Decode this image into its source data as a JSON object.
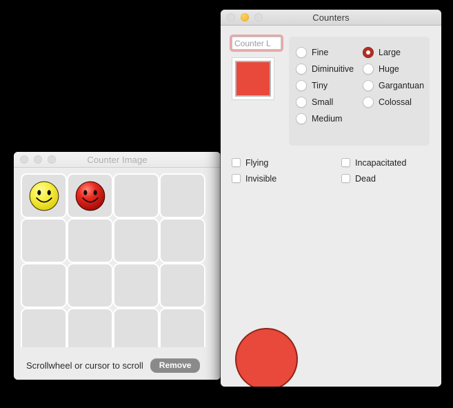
{
  "desktop": {
    "background_color": "#000000"
  },
  "counter_image_window": {
    "title": "Counter Image",
    "active": false,
    "traffic_lights": [
      {
        "name": "close-button",
        "color": "#dcdcdc"
      },
      {
        "name": "minimize-button",
        "color": "#dcdcdc"
      },
      {
        "name": "zoom-button",
        "color": "#dcdcdc"
      }
    ],
    "grid": {
      "columns": 4,
      "rows": 4,
      "cells": [
        {
          "icon": "smiley-face-icon",
          "color": "#f2e838",
          "filled": true
        },
        {
          "icon": "smiley-face-icon",
          "color": "#e02020",
          "filled": true
        },
        {
          "icon": "",
          "color": "",
          "filled": false
        },
        {
          "icon": "",
          "color": "",
          "filled": false
        },
        {
          "icon": "",
          "color": "",
          "filled": false
        },
        {
          "icon": "",
          "color": "",
          "filled": false
        },
        {
          "icon": "",
          "color": "",
          "filled": false
        },
        {
          "icon": "",
          "color": "",
          "filled": false
        },
        {
          "icon": "",
          "color": "",
          "filled": false
        },
        {
          "icon": "",
          "color": "",
          "filled": false
        },
        {
          "icon": "",
          "color": "",
          "filled": false
        },
        {
          "icon": "",
          "color": "",
          "filled": false
        },
        {
          "icon": "",
          "color": "",
          "filled": false
        },
        {
          "icon": "",
          "color": "",
          "filled": false
        },
        {
          "icon": "",
          "color": "",
          "filled": false
        },
        {
          "icon": "",
          "color": "",
          "filled": false
        }
      ]
    },
    "hint": "Scrollwheel or cursor to scroll",
    "remove_label": "Remove"
  },
  "counters_window": {
    "title": "Counters",
    "active": true,
    "traffic_lights": [
      {
        "name": "close-button",
        "color": "#dcdcdc"
      },
      {
        "name": "minimize-button",
        "color": "#f6bb35"
      },
      {
        "name": "zoom-button",
        "color": "#dcdcdc"
      }
    ],
    "name_field": {
      "value": "Counter L",
      "placeholder": "Counter Label",
      "focused": true,
      "focus_ring_color": "#e27373"
    },
    "color_well": {
      "label": "counter-color",
      "color": "#e8493a"
    },
    "size_radios": {
      "selected": "Large",
      "selected_color": "#b03024",
      "left_column": [
        "Fine",
        "Diminuitive",
        "Tiny",
        "Small",
        "Medium"
      ],
      "right_column": [
        "Large",
        "Huge",
        "Gargantuan",
        "Colossal"
      ]
    },
    "status_checkboxes": {
      "left_column": [
        {
          "label": "Flying",
          "checked": false
        },
        {
          "label": "Invisible",
          "checked": false
        }
      ],
      "right_column": [
        {
          "label": "Incapacitated",
          "checked": false
        },
        {
          "label": "Dead",
          "checked": false
        }
      ]
    },
    "preview": {
      "shape": "circle",
      "fill_color": "#e8493a",
      "stroke_color": "#8f2419"
    }
  }
}
